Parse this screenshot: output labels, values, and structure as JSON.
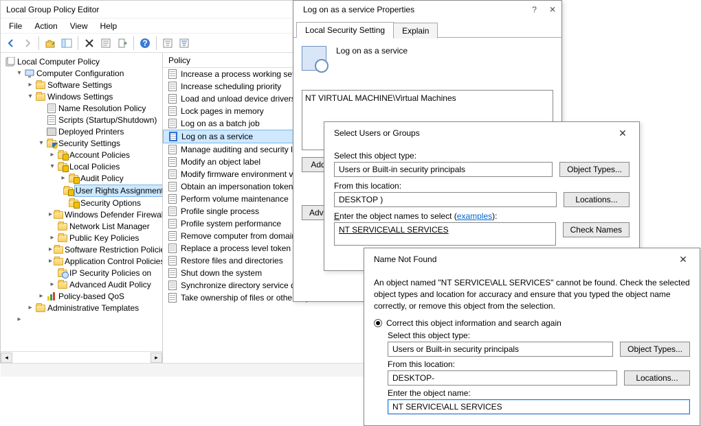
{
  "main": {
    "title": "Local Group Policy Editor",
    "menus": [
      "File",
      "Action",
      "View",
      "Help"
    ],
    "tree_root": "Local Computer Policy",
    "cc": "Computer Configuration",
    "software": "Software Settings",
    "windows": "Windows Settings",
    "nrp": "Name Resolution Policy",
    "scripts": "Scripts (Startup/Shutdown)",
    "printers": "Deployed Printers",
    "security": "Security Settings",
    "account": "Account Policies",
    "local": "Local Policies",
    "audit": "Audit Policy",
    "ura": "User Rights Assignment",
    "secopt": "Security Options",
    "wdf": "Windows Defender Firewall",
    "nlm": "Network List Manager",
    "pkp": "Public Key Policies",
    "srp": "Software Restriction Policies",
    "acp": "Application Control Policies",
    "ips": "IP Security Policies on",
    "aap": "Advanced Audit Policy",
    "qos": "Policy-based QoS",
    "adm": "Administrative Templates"
  },
  "policy_header": "Policy",
  "policies": {
    "p0": "Increase a process working set",
    "p1": "Increase scheduling priority",
    "p2": "Load and unload device drivers",
    "p3": "Lock pages in memory",
    "p4": "Log on as a batch job",
    "p5": "Log on as a service",
    "p6": "Manage auditing and security log",
    "p7": "Modify an object label",
    "p8": "Modify firmware environment values",
    "p9": "Obtain an impersonation token",
    "p10": "Perform volume maintenance",
    "p11": "Profile single process",
    "p12": "Profile system performance",
    "p13": "Remove computer from domain",
    "p14": "Replace a process level token",
    "p15": "Restore files and directories",
    "p16": "Shut down the system",
    "p17": "Synchronize directory service data",
    "p18": "Take ownership of files or other objects"
  },
  "props": {
    "title": "Log on as a service Properties",
    "tab_local": "Local Security Setting",
    "tab_explain": "Explain",
    "desc": "Log on as a service",
    "entry": "NT VIRTUAL MACHINE\\Virtual Machines",
    "add_btn": "Add…",
    "adv_btn": "Advanced…"
  },
  "select": {
    "title": "Select Users or Groups",
    "obj_label": "Select this object type:",
    "obj_val": "Users or Built-in security principals",
    "obj_btn": "Object Types...",
    "loc_label": "From this location:",
    "loc_val": "DESKTOP          )",
    "loc_btn": "Locations...",
    "names_label_pre": "Enter the object names to select (",
    "names_label_link": "examples",
    "names_val": "NT SERVICE\\ALL SERVICES",
    "check_btn": "Check Names"
  },
  "notfound": {
    "title": "Name Not Found",
    "msg": "An object named \"NT SERVICE\\ALL SERVICES\" cannot be found. Check the selected object types and location for accuracy and ensure that you typed the object name correctly, or remove this object from the selection.",
    "radio1": "Correct this object information and search again",
    "obj_label": "Select this object type:",
    "obj_val": "Users or Built-in security principals",
    "obj_btn": "Object Types...",
    "loc_label": "From this location:",
    "loc_val": "DESKTOP-",
    "loc_btn": "Locations...",
    "name_label": "Enter the object name:",
    "name_val": "NT SERVICE\\ALL SERVICES"
  }
}
